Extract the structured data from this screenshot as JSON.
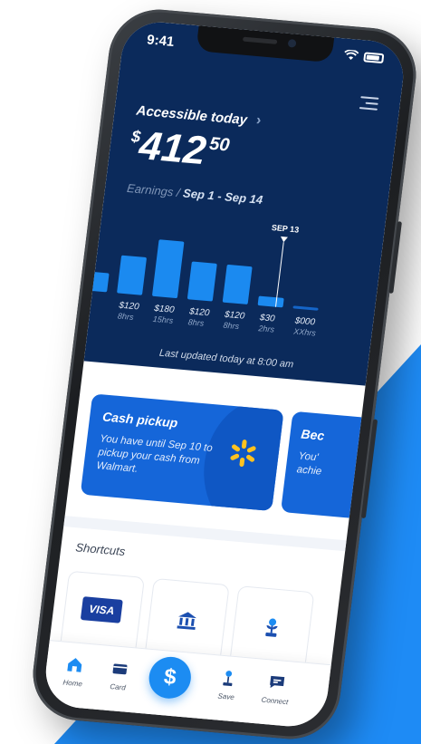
{
  "colors": {
    "hero_bg": "#0b2a5b",
    "accent": "#1c8cf2",
    "bar": "#1b8af0",
    "card": "#1566d9",
    "walmart_yellow": "#ffc220"
  },
  "status_bar": {
    "time": "9:41",
    "icons": [
      "wifi-icon",
      "battery-icon"
    ]
  },
  "header": {
    "menu_icon": "menu-icon",
    "accessible_label": "Accessible today",
    "chevron": "›",
    "currency": "$",
    "amount_dollars": "412",
    "amount_cents": "50",
    "earnings_label": "Earnings /",
    "period": "Sep 1 - Sep 14"
  },
  "chart_data": {
    "type": "bar",
    "title": "",
    "marker_label": "SEP 13",
    "categories": [
      "",
      "$120 8hrs",
      "$180 15hrs",
      "$120 8hrs",
      "$120 8hrs",
      "$30 2hrs",
      "$000 XXhrs"
    ],
    "values": [
      60,
      120,
      180,
      120,
      120,
      30,
      0
    ],
    "amount_labels": [
      "",
      "$120",
      "$180",
      "$120",
      "$120",
      "$30",
      "$000"
    ],
    "hour_labels": [
      "",
      "8hrs",
      "15hrs",
      "8hrs",
      "8hrs",
      "2hrs",
      "XXhrs"
    ],
    "ylim": [
      0,
      200
    ],
    "highlight_index": 5
  },
  "last_updated": "Last updated today at 8:00 am",
  "cards": {
    "cash_pickup": {
      "title": "Cash pickup",
      "body": "You have until Sep 10 to pickup your cash from Walmart.",
      "icon": "walmart-spark-icon"
    },
    "next_card": {
      "title": "Bec",
      "body_line1": "You'",
      "body_line2": "achie"
    }
  },
  "shortcuts": {
    "title": "Shortcuts",
    "items": [
      {
        "icon": "visa-card-icon",
        "text": "VISA"
      },
      {
        "icon": "bank-icon"
      },
      {
        "icon": "savings-plant-icon"
      }
    ]
  },
  "tabbar": {
    "home": "Home",
    "card": "Card",
    "pay": "$",
    "save": "Save",
    "connect": "Connect"
  }
}
